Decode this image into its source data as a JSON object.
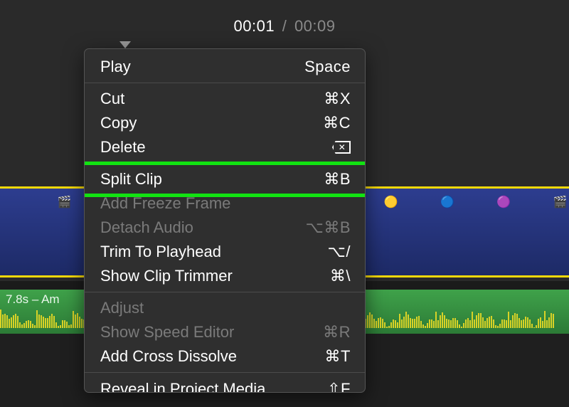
{
  "timecode": {
    "current": "00:01",
    "total": "00:09"
  },
  "audio": {
    "label": "7.8s – Am"
  },
  "menu": {
    "play": {
      "label": "Play",
      "shortcut": "Space"
    },
    "cut": {
      "label": "Cut",
      "shortcut": "⌘X"
    },
    "copy": {
      "label": "Copy",
      "shortcut": "⌘C"
    },
    "delete": {
      "label": "Delete"
    },
    "split": {
      "label": "Split Clip",
      "shortcut": "⌘B"
    },
    "freeze": {
      "label": "Add Freeze Frame"
    },
    "detach": {
      "label": "Detach Audio",
      "shortcut": "⌥⌘B"
    },
    "trim": {
      "label": "Trim To Playhead",
      "shortcut": "⌥/"
    },
    "trimmer": {
      "label": "Show Clip Trimmer",
      "shortcut": "⌘\\"
    },
    "adjust": {
      "label": "Adjust"
    },
    "speed": {
      "label": "Show Speed Editor",
      "shortcut": "⌘R"
    },
    "dissolve": {
      "label": "Add Cross Dissolve",
      "shortcut": "⌘T"
    },
    "reveal": {
      "label": "Reveal in Project Media",
      "shortcut": "⇧F"
    }
  }
}
